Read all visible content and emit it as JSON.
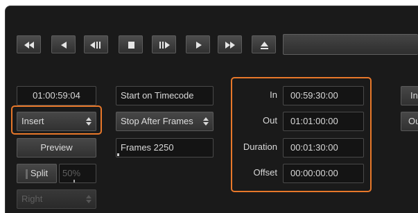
{
  "transport": {
    "buttons": [
      {
        "name": "rewind-button",
        "icon": "rewind-icon"
      },
      {
        "name": "play-reverse-button",
        "icon": "play-reverse-icon"
      },
      {
        "name": "step-back-button",
        "icon": "step-back-icon"
      },
      {
        "name": "stop-button",
        "icon": "stop-icon"
      },
      {
        "name": "step-forward-button",
        "icon": "step-forward-icon"
      },
      {
        "name": "play-button",
        "icon": "play-icon"
      },
      {
        "name": "fast-forward-button",
        "icon": "fast-forward-icon"
      },
      {
        "name": "eject-button",
        "icon": "eject-icon"
      }
    ]
  },
  "left": {
    "timecode": "01:00:59:04",
    "edit_mode": "Insert",
    "preview_label": "Preview",
    "split_label": "Split",
    "split_value": "50%",
    "split_side": "Right"
  },
  "middle": {
    "start_on_timecode": "Start on Timecode",
    "stop_mode": "Stop After Frames",
    "frames_field": "Frames 2250"
  },
  "points": {
    "in_label": "In",
    "in_value": "00:59:30:00",
    "out_label": "Out",
    "out_value": "01:01:00:00",
    "duration_label": "Duration",
    "duration_value": "00:01:30:00",
    "offset_label": "Offset",
    "offset_value": "00:00:00:00"
  },
  "right_cut": {
    "in_button": "In",
    "out_button": "Ou"
  },
  "colors": {
    "highlight": "#e8782a",
    "panel": "#1a1a1a"
  }
}
